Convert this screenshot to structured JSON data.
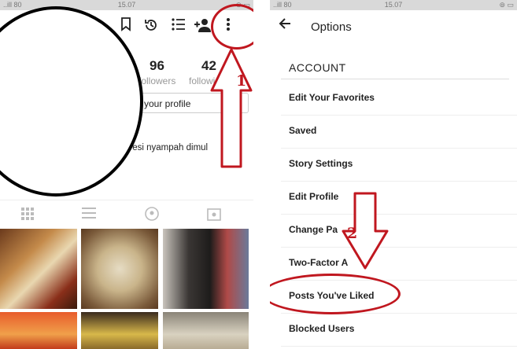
{
  "status_bar": {
    "signal": "..ill 80",
    "time": "15.07",
    "battery": "⊚ ▭"
  },
  "left_screen": {
    "toolbar_icons": [
      "bookmark-icon",
      "history-icon",
      "list-icon",
      "add-user-icon",
      "more-vert-icon"
    ],
    "stats": [
      {
        "value": "96",
        "label": "followers"
      },
      {
        "value": "42",
        "label": "following"
      }
    ],
    "edit_profile_label": "your profile",
    "bio": "presi nyampah dimul",
    "tabs": [
      "grid-icon",
      "list-icon",
      "tagged-icon",
      "saved-icon"
    ],
    "colors": {
      "text": "#222222",
      "muted": "#999999",
      "annotation": "#c0171f"
    }
  },
  "right_screen": {
    "title": "Options",
    "section": "ACCOUNT",
    "items": [
      "Edit Your Favorites",
      "Saved",
      "Story Settings",
      "Edit Profile",
      "Change Pa",
      "Two-Factor A",
      "Posts You've Liked",
      "Blocked Users"
    ]
  },
  "annotations": {
    "step1": "1",
    "step2": "2"
  }
}
